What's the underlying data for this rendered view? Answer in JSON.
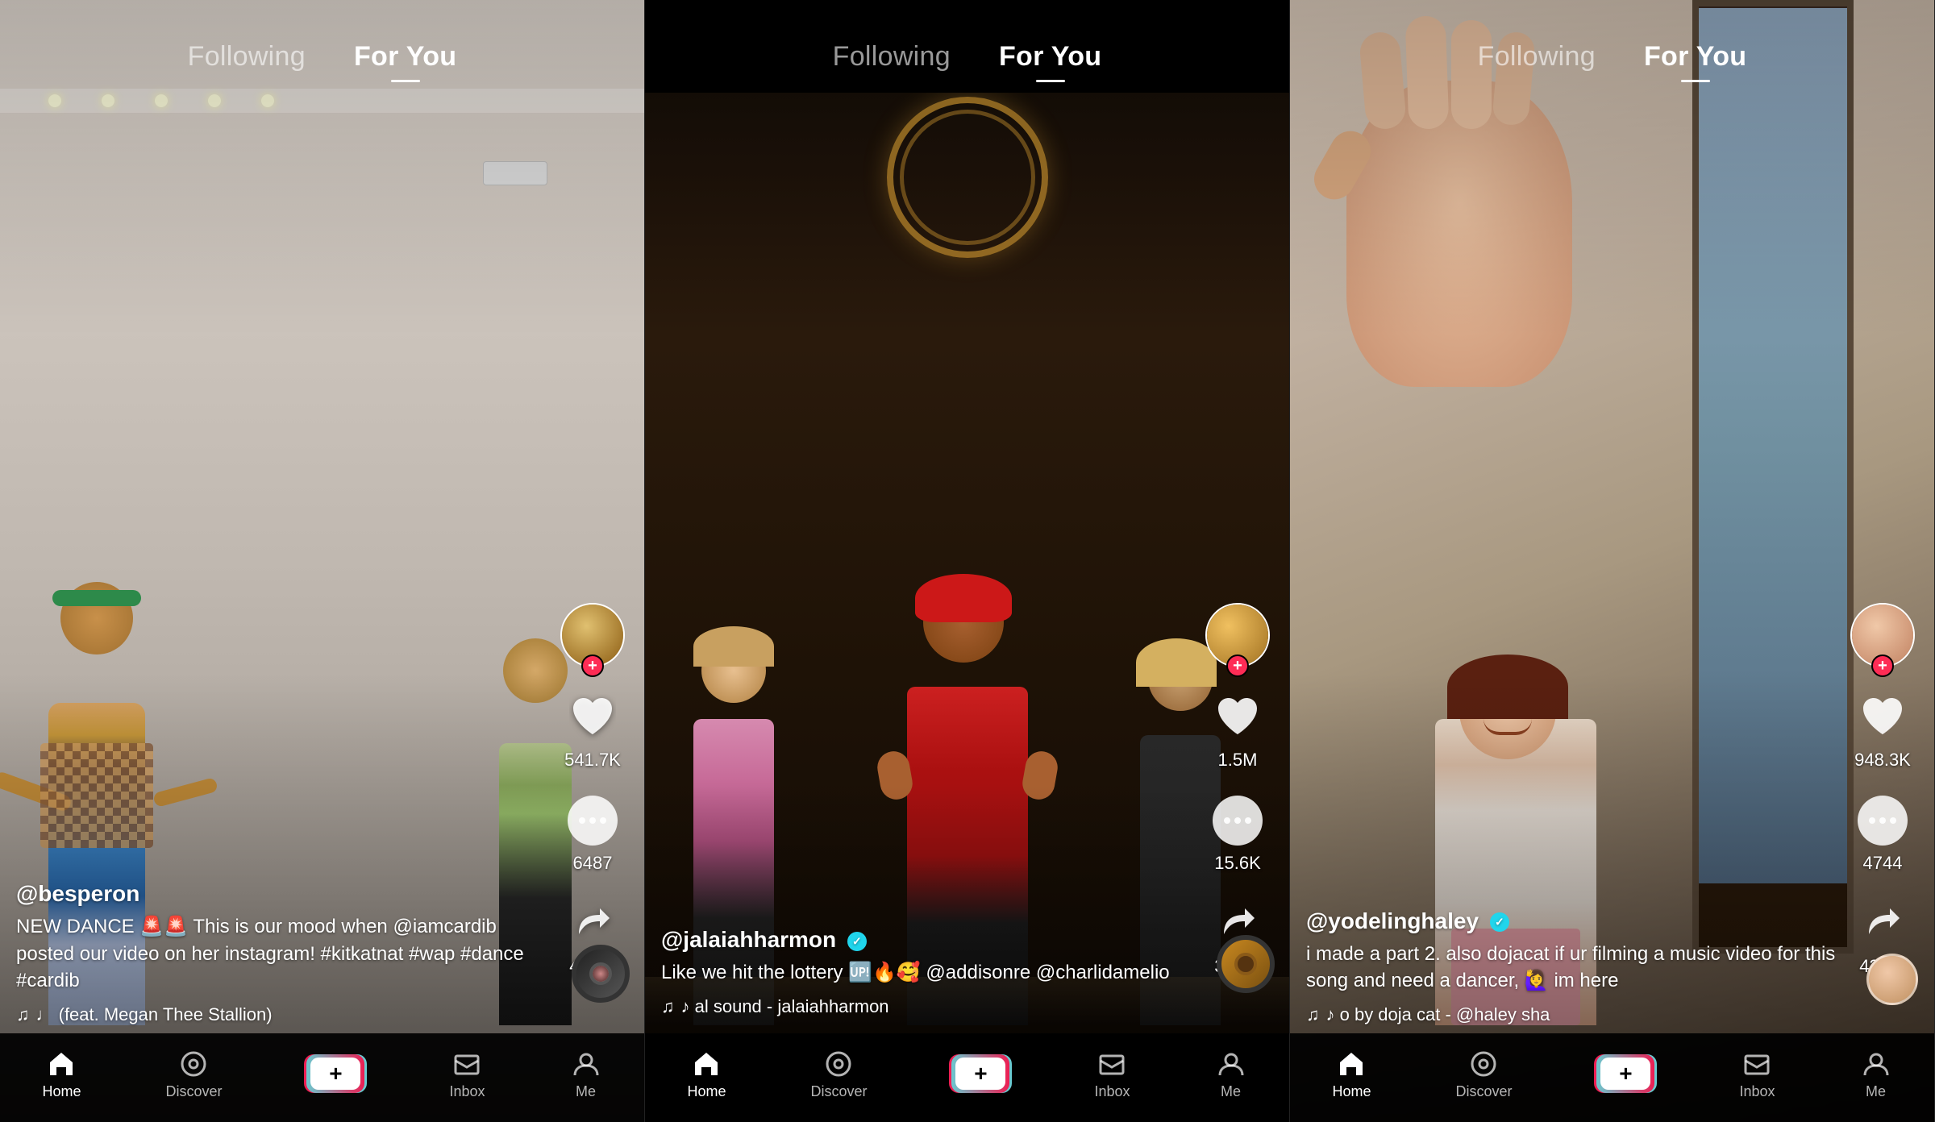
{
  "panels": [
    {
      "id": "panel1",
      "nav": {
        "following": "Following",
        "for_you": "For You",
        "active": "for_you"
      },
      "video": {
        "bg_color": "#c8b8a8",
        "style": "light_room_dance"
      },
      "actions": {
        "likes": "541.7K",
        "comments": "6487",
        "shares": "42.4K"
      },
      "user": {
        "handle": "@besperon",
        "verified": false,
        "avatar_color": "#8B6914"
      },
      "description": "NEW DANCE 🚨🚨 This is our mood when @iamcardib posted our video on her instagram! #kitkatnat #wap #dance #cardib",
      "music": "♩ (feat. Megan Thee Stallion)",
      "bottom_nav": {
        "home": "Home",
        "discover": "Discover",
        "inbox": "Inbox",
        "me": "Me"
      }
    },
    {
      "id": "panel2",
      "nav": {
        "following": "Following",
        "for_you": "For You",
        "active": "for_you"
      },
      "video": {
        "bg_color": "#1a0e05",
        "style": "dark_hotel"
      },
      "actions": {
        "likes": "1.5M",
        "comments": "15.6K",
        "shares": "31.1K"
      },
      "user": {
        "handle": "@jalaiahharmon",
        "verified": true,
        "avatar_color": "#c8880a"
      },
      "description": "Like we hit the lottery 🆙🔥🥰 @addisonre @charlidamelio",
      "music": "♪ al sound - jalaiahharmon",
      "bottom_nav": {
        "home": "Home",
        "discover": "Discover",
        "inbox": "Inbox",
        "me": "Me"
      }
    },
    {
      "id": "panel3",
      "nav": {
        "following": "Following",
        "for_you": "For You",
        "active": "for_you"
      },
      "video": {
        "bg_color": "#b8a898",
        "style": "room_door"
      },
      "actions": {
        "likes": "948.3K",
        "comments": "4744",
        "shares": "43.5K"
      },
      "user": {
        "handle": "@yodelinghaley",
        "verified": true,
        "avatar_color": "#c8a090"
      },
      "description": "i made a part 2. also dojacat if ur filming a music video for this song and need a dancer, 🙋‍♀️ im here",
      "music": "♪ o by doja cat - @haley sha",
      "bottom_nav": {
        "home": "Home",
        "discover": "Discover",
        "inbox": "Inbox",
        "me": "Me"
      }
    }
  ],
  "icons": {
    "home": "🏠",
    "discover": "🔍",
    "inbox": "📬",
    "me": "👤",
    "music_note": "♪",
    "plus": "+"
  }
}
